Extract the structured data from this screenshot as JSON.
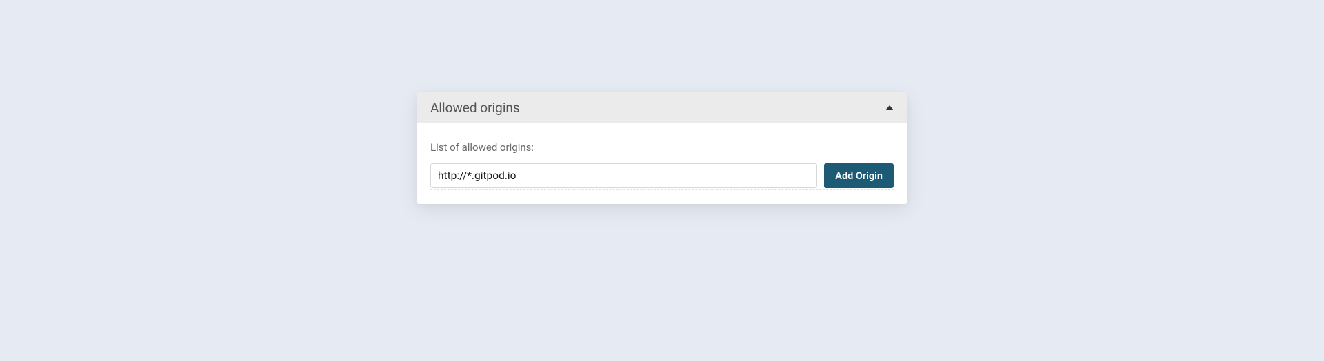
{
  "panel": {
    "title": "Allowed origins",
    "list_label": "List of allowed origins:",
    "origin_input_value": "http://*.gitpod.io",
    "add_button_label": "Add Origin"
  }
}
